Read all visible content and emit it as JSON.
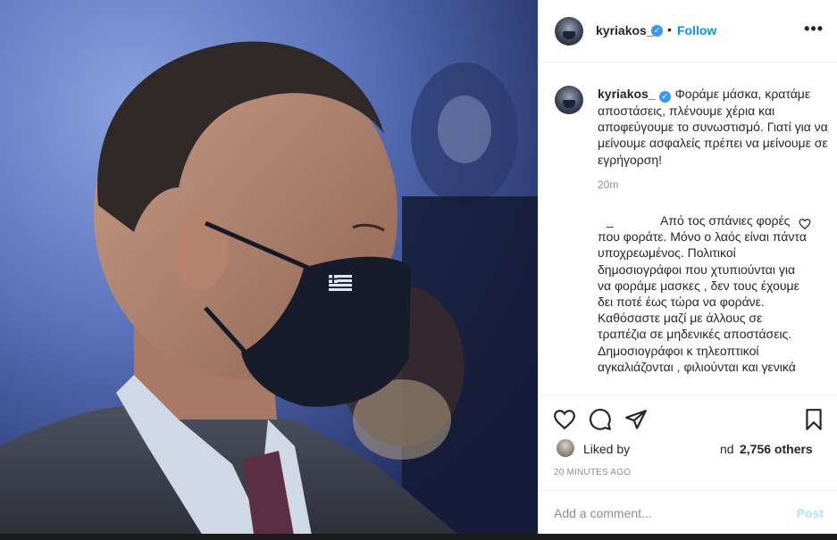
{
  "header": {
    "username": "kyriakos_",
    "separator": "•",
    "follow_label": "Follow",
    "more_label": "•••"
  },
  "caption": {
    "username": "kyriakos_",
    "text": "Φοράμε μάσκα, κρατάμε αποστάσεις, πλένουμε χέρια και αποφεύγουμε το συνωστισμό. Γιατί για να μείνουμε ασφαλείς πρέπει να μείνουμε σε εγρήγορση!",
    "time": "20m"
  },
  "comment": {
    "username": "_",
    "text": "Από τος σπάνιες φορές που φοράτε. Μόνο ο λαός είναι πάντα υποχρεωμένος. Πολιτικοί δημοσιογράφοι που χτυπιούνται για να φοράμε μασκες , δεν τους έχουμε δει ποτέ έως τώρα να φοράνε. Καθόσαστε μαζί με άλλους σε τραπέζια σε μηδενικές αποστάσεις. Δημοσιογράφοι κ τηλεοπτικοί αγκαλιάζονται , φιλιούνται και γενικά"
  },
  "actions": {
    "icons": [
      "heart-icon",
      "comment-icon",
      "share-icon",
      "bookmark-icon"
    ],
    "liked_by_label": "Liked by",
    "and_label": "nd",
    "likes_count": "2,756 others",
    "timestamp": "20 MINUTES AGO"
  },
  "add_comment": {
    "placeholder": "Add a comment...",
    "post_label": "Post"
  },
  "colors": {
    "link": "#0095f6",
    "verified": "#3897f0",
    "muted": "#8e8e8e",
    "post_disabled": "#b2dffc"
  }
}
